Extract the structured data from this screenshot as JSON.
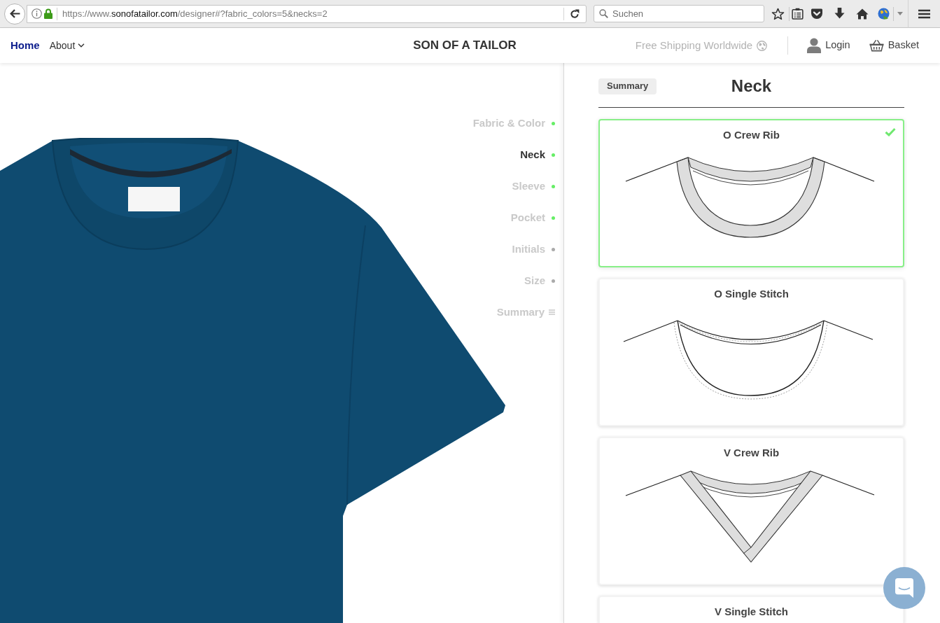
{
  "browser": {
    "url": {
      "scheme": "https://www.",
      "domain": "sonofatailor.com",
      "path": "/designer#?fabric_colors=5&necks=2"
    },
    "search": {
      "placeholder": "Suchen"
    }
  },
  "header": {
    "nav": [
      {
        "label": "Home",
        "selected": true,
        "kind": "link"
      },
      {
        "label": "About",
        "selected": false,
        "kind": "dropdown"
      }
    ],
    "logo": "SON OF A TAILOR",
    "shipping": "Free Shipping Worldwide",
    "actions": [
      {
        "label": "Login",
        "kind": "account"
      },
      {
        "label": "Basket",
        "kind": "basket"
      }
    ]
  },
  "steps": [
    {
      "label": "Fabric & Color",
      "selected": false,
      "kind": "step",
      "color": "#66ee66"
    },
    {
      "label": "Neck",
      "selected": true,
      "kind": "step",
      "color": "#66ee66"
    },
    {
      "label": "Sleeve",
      "selected": false,
      "kind": "step",
      "color": "#66ee66"
    },
    {
      "label": "Pocket",
      "selected": false,
      "kind": "step",
      "color": "#66ee66"
    },
    {
      "label": "Initials",
      "selected": false,
      "kind": "step",
      "color": "#aaaaaa"
    },
    {
      "label": "Size",
      "selected": false,
      "kind": "step",
      "color": "#aaaaaa"
    },
    {
      "label": "Summary",
      "selected": false,
      "kind": "summary"
    }
  ],
  "panel": {
    "summary_button": "Summary",
    "title": "Neck",
    "options": [
      {
        "name": "O Crew Rib",
        "kind": "o-crew-rib",
        "selected": true
      },
      {
        "name": "O Single Stitch",
        "kind": "o-single-stitch",
        "selected": false
      },
      {
        "name": "V Crew Rib",
        "kind": "v-crew-rib",
        "selected": false
      },
      {
        "name": "V Single Stitch",
        "selected": false
      }
    ]
  }
}
